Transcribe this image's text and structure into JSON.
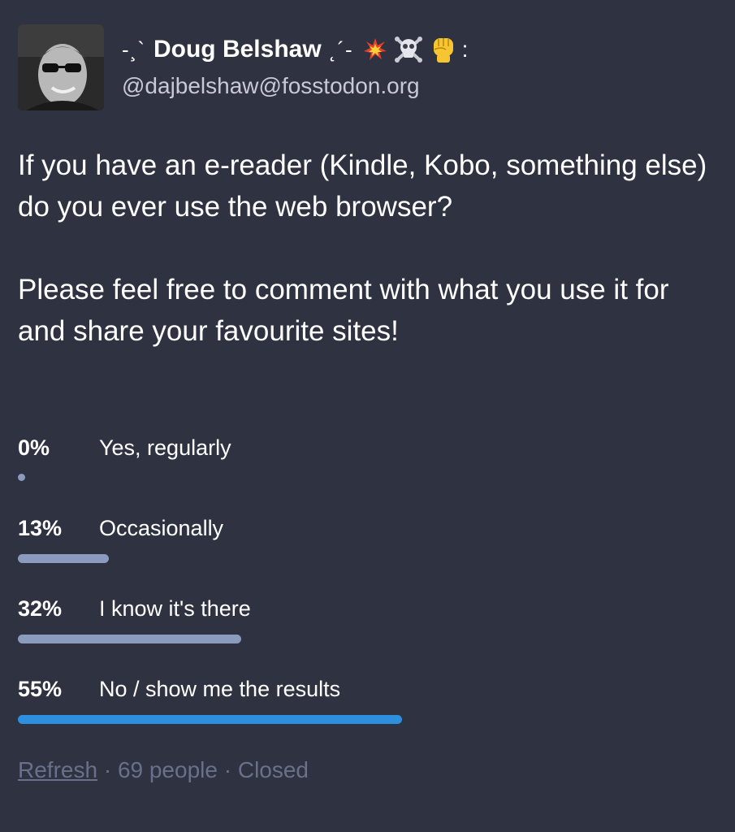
{
  "account": {
    "display_name_prefix": "-¸`",
    "display_name": "Doug Belshaw",
    "display_name_suffix": "˛´-",
    "emoji": [
      "collision-icon",
      "skull-crossbones-icon",
      "raised-fist-icon"
    ],
    "display_name_end": ":",
    "handle": "@dajbelshaw@fosstodon.org"
  },
  "status": {
    "paragraphs": [
      "If you have an e-reader (Kindle, Kobo, something else) do you ever use the web browser?",
      "Please feel free to comment with what you use it for and share your favourite sites!"
    ]
  },
  "poll": {
    "options": [
      {
        "percent_label": "0%",
        "percent": 0,
        "label": "Yes, regularly",
        "leading": false
      },
      {
        "percent_label": "13%",
        "percent": 13,
        "label": "Occasionally",
        "leading": false
      },
      {
        "percent_label": "32%",
        "percent": 32,
        "label": "I know it's there",
        "leading": false
      },
      {
        "percent_label": "55%",
        "percent": 55,
        "label": "No / show me the results",
        "leading": true
      }
    ],
    "footer": {
      "refresh_label": "Refresh",
      "separator": "·",
      "voters": "69 people",
      "status": "Closed"
    }
  },
  "colors": {
    "background": "#2f3241",
    "bar": "#8a9bbd",
    "bar_leading": "#2d8fdd",
    "muted_text": "#6b708a"
  }
}
